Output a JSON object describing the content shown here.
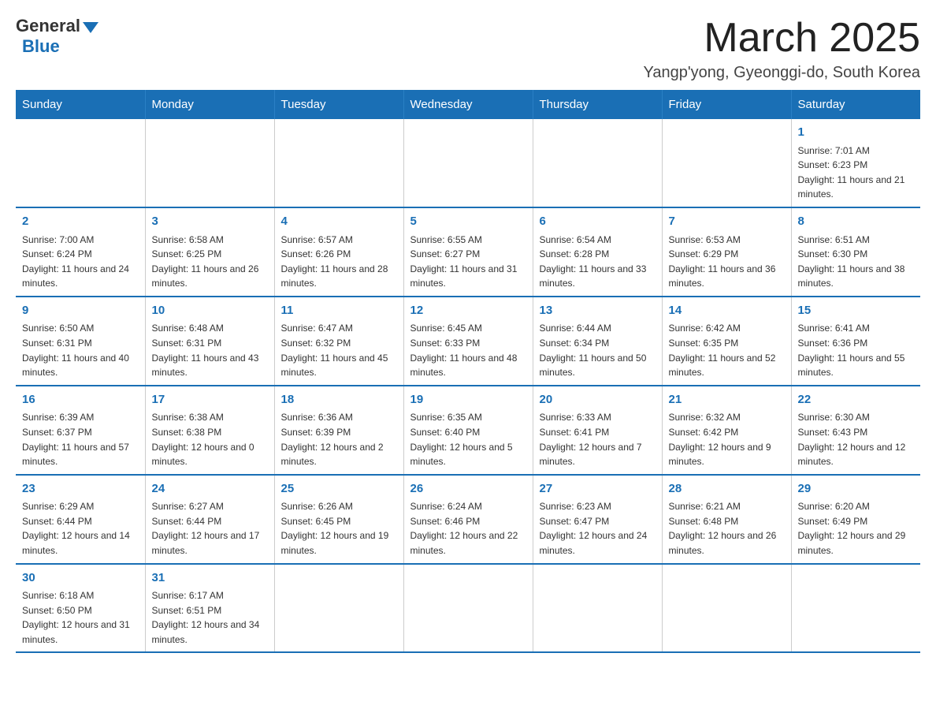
{
  "header": {
    "logo_text": "General",
    "logo_blue": "Blue",
    "title": "March 2025",
    "subtitle": "Yangp'yong, Gyeonggi-do, South Korea"
  },
  "days_of_week": [
    "Sunday",
    "Monday",
    "Tuesday",
    "Wednesday",
    "Thursday",
    "Friday",
    "Saturday"
  ],
  "weeks": [
    [
      {
        "day": "",
        "sunrise": "",
        "sunset": "",
        "daylight": ""
      },
      {
        "day": "",
        "sunrise": "",
        "sunset": "",
        "daylight": ""
      },
      {
        "day": "",
        "sunrise": "",
        "sunset": "",
        "daylight": ""
      },
      {
        "day": "",
        "sunrise": "",
        "sunset": "",
        "daylight": ""
      },
      {
        "day": "",
        "sunrise": "",
        "sunset": "",
        "daylight": ""
      },
      {
        "day": "",
        "sunrise": "",
        "sunset": "",
        "daylight": ""
      },
      {
        "day": "1",
        "sunrise": "Sunrise: 7:01 AM",
        "sunset": "Sunset: 6:23 PM",
        "daylight": "Daylight: 11 hours and 21 minutes."
      }
    ],
    [
      {
        "day": "2",
        "sunrise": "Sunrise: 7:00 AM",
        "sunset": "Sunset: 6:24 PM",
        "daylight": "Daylight: 11 hours and 24 minutes."
      },
      {
        "day": "3",
        "sunrise": "Sunrise: 6:58 AM",
        "sunset": "Sunset: 6:25 PM",
        "daylight": "Daylight: 11 hours and 26 minutes."
      },
      {
        "day": "4",
        "sunrise": "Sunrise: 6:57 AM",
        "sunset": "Sunset: 6:26 PM",
        "daylight": "Daylight: 11 hours and 28 minutes."
      },
      {
        "day": "5",
        "sunrise": "Sunrise: 6:55 AM",
        "sunset": "Sunset: 6:27 PM",
        "daylight": "Daylight: 11 hours and 31 minutes."
      },
      {
        "day": "6",
        "sunrise": "Sunrise: 6:54 AM",
        "sunset": "Sunset: 6:28 PM",
        "daylight": "Daylight: 11 hours and 33 minutes."
      },
      {
        "day": "7",
        "sunrise": "Sunrise: 6:53 AM",
        "sunset": "Sunset: 6:29 PM",
        "daylight": "Daylight: 11 hours and 36 minutes."
      },
      {
        "day": "8",
        "sunrise": "Sunrise: 6:51 AM",
        "sunset": "Sunset: 6:30 PM",
        "daylight": "Daylight: 11 hours and 38 minutes."
      }
    ],
    [
      {
        "day": "9",
        "sunrise": "Sunrise: 6:50 AM",
        "sunset": "Sunset: 6:31 PM",
        "daylight": "Daylight: 11 hours and 40 minutes."
      },
      {
        "day": "10",
        "sunrise": "Sunrise: 6:48 AM",
        "sunset": "Sunset: 6:31 PM",
        "daylight": "Daylight: 11 hours and 43 minutes."
      },
      {
        "day": "11",
        "sunrise": "Sunrise: 6:47 AM",
        "sunset": "Sunset: 6:32 PM",
        "daylight": "Daylight: 11 hours and 45 minutes."
      },
      {
        "day": "12",
        "sunrise": "Sunrise: 6:45 AM",
        "sunset": "Sunset: 6:33 PM",
        "daylight": "Daylight: 11 hours and 48 minutes."
      },
      {
        "day": "13",
        "sunrise": "Sunrise: 6:44 AM",
        "sunset": "Sunset: 6:34 PM",
        "daylight": "Daylight: 11 hours and 50 minutes."
      },
      {
        "day": "14",
        "sunrise": "Sunrise: 6:42 AM",
        "sunset": "Sunset: 6:35 PM",
        "daylight": "Daylight: 11 hours and 52 minutes."
      },
      {
        "day": "15",
        "sunrise": "Sunrise: 6:41 AM",
        "sunset": "Sunset: 6:36 PM",
        "daylight": "Daylight: 11 hours and 55 minutes."
      }
    ],
    [
      {
        "day": "16",
        "sunrise": "Sunrise: 6:39 AM",
        "sunset": "Sunset: 6:37 PM",
        "daylight": "Daylight: 11 hours and 57 minutes."
      },
      {
        "day": "17",
        "sunrise": "Sunrise: 6:38 AM",
        "sunset": "Sunset: 6:38 PM",
        "daylight": "Daylight: 12 hours and 0 minutes."
      },
      {
        "day": "18",
        "sunrise": "Sunrise: 6:36 AM",
        "sunset": "Sunset: 6:39 PM",
        "daylight": "Daylight: 12 hours and 2 minutes."
      },
      {
        "day": "19",
        "sunrise": "Sunrise: 6:35 AM",
        "sunset": "Sunset: 6:40 PM",
        "daylight": "Daylight: 12 hours and 5 minutes."
      },
      {
        "day": "20",
        "sunrise": "Sunrise: 6:33 AM",
        "sunset": "Sunset: 6:41 PM",
        "daylight": "Daylight: 12 hours and 7 minutes."
      },
      {
        "day": "21",
        "sunrise": "Sunrise: 6:32 AM",
        "sunset": "Sunset: 6:42 PM",
        "daylight": "Daylight: 12 hours and 9 minutes."
      },
      {
        "day": "22",
        "sunrise": "Sunrise: 6:30 AM",
        "sunset": "Sunset: 6:43 PM",
        "daylight": "Daylight: 12 hours and 12 minutes."
      }
    ],
    [
      {
        "day": "23",
        "sunrise": "Sunrise: 6:29 AM",
        "sunset": "Sunset: 6:44 PM",
        "daylight": "Daylight: 12 hours and 14 minutes."
      },
      {
        "day": "24",
        "sunrise": "Sunrise: 6:27 AM",
        "sunset": "Sunset: 6:44 PM",
        "daylight": "Daylight: 12 hours and 17 minutes."
      },
      {
        "day": "25",
        "sunrise": "Sunrise: 6:26 AM",
        "sunset": "Sunset: 6:45 PM",
        "daylight": "Daylight: 12 hours and 19 minutes."
      },
      {
        "day": "26",
        "sunrise": "Sunrise: 6:24 AM",
        "sunset": "Sunset: 6:46 PM",
        "daylight": "Daylight: 12 hours and 22 minutes."
      },
      {
        "day": "27",
        "sunrise": "Sunrise: 6:23 AM",
        "sunset": "Sunset: 6:47 PM",
        "daylight": "Daylight: 12 hours and 24 minutes."
      },
      {
        "day": "28",
        "sunrise": "Sunrise: 6:21 AM",
        "sunset": "Sunset: 6:48 PM",
        "daylight": "Daylight: 12 hours and 26 minutes."
      },
      {
        "day": "29",
        "sunrise": "Sunrise: 6:20 AM",
        "sunset": "Sunset: 6:49 PM",
        "daylight": "Daylight: 12 hours and 29 minutes."
      }
    ],
    [
      {
        "day": "30",
        "sunrise": "Sunrise: 6:18 AM",
        "sunset": "Sunset: 6:50 PM",
        "daylight": "Daylight: 12 hours and 31 minutes."
      },
      {
        "day": "31",
        "sunrise": "Sunrise: 6:17 AM",
        "sunset": "Sunset: 6:51 PM",
        "daylight": "Daylight: 12 hours and 34 minutes."
      },
      {
        "day": "",
        "sunrise": "",
        "sunset": "",
        "daylight": ""
      },
      {
        "day": "",
        "sunrise": "",
        "sunset": "",
        "daylight": ""
      },
      {
        "day": "",
        "sunrise": "",
        "sunset": "",
        "daylight": ""
      },
      {
        "day": "",
        "sunrise": "",
        "sunset": "",
        "daylight": ""
      },
      {
        "day": "",
        "sunrise": "",
        "sunset": "",
        "daylight": ""
      }
    ]
  ]
}
